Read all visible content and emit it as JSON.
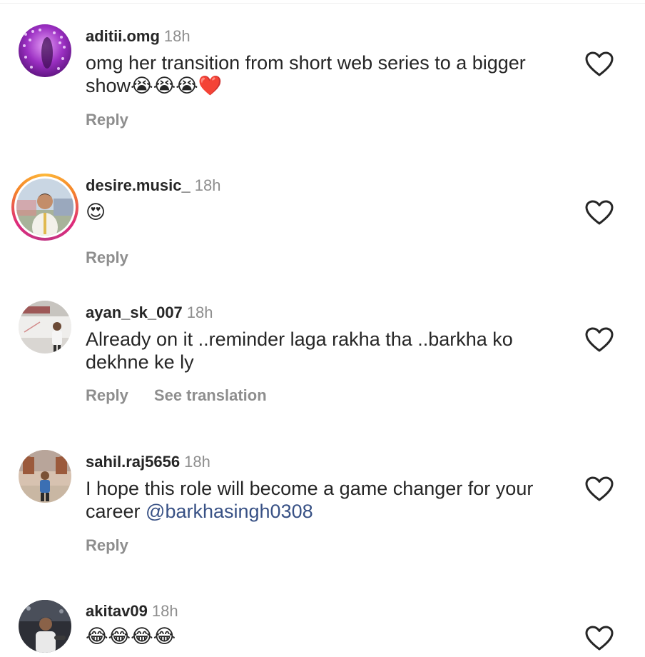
{
  "comments": [
    {
      "username": "aditii.omg",
      "time": "18h",
      "text": "omg her transition from short web series to a bigger show",
      "emojis": "😭😭😭❤️",
      "actions": [
        "Reply"
      ]
    },
    {
      "username": "desire.music_",
      "time": "18h",
      "text": "",
      "emojis": "😍",
      "actions": [
        "Reply"
      ]
    },
    {
      "username": "ayan_sk_007",
      "time": "18h",
      "text": "Already on it ..reminder laga rakha tha ..barkha ko dekhne ke ly",
      "emojis": "",
      "actions": [
        "Reply",
        "See translation"
      ]
    },
    {
      "username": "sahil.raj5656",
      "time": "18h",
      "text": "I hope this role will become a game changer for your career",
      "mention": "@barkhasingh0308",
      "emojis": "",
      "actions": [
        "Reply"
      ]
    },
    {
      "username": "akitav09",
      "time": "18h",
      "text": "",
      "emojis": "😂😂😂😂",
      "actions": []
    }
  ],
  "icons": {
    "like": "heart-outline-icon"
  },
  "colors": {
    "mention": "#385185",
    "secondary_text": "#8e8e8e",
    "primary_text": "#262626"
  }
}
